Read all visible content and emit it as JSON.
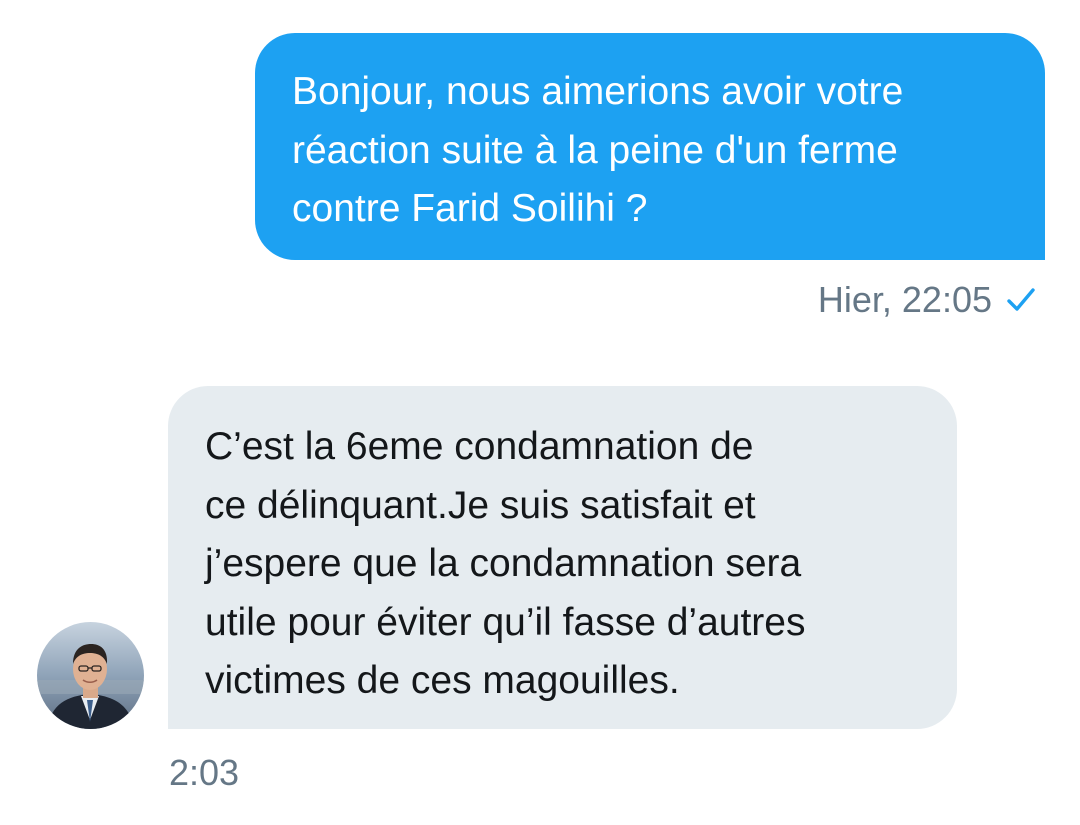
{
  "conversation": {
    "sent_message": {
      "lines": [
        "Bonjour, nous aimerions avoir votre",
        "réaction suite à la peine d'un ferme",
        "contre Farid Soilihi ?"
      ],
      "timestamp": "Hier, 22:05",
      "status_icon": "check-icon",
      "bubble_color": "#1da1f2"
    },
    "received_message": {
      "lines": [
        "C’est la 6eme condamnation de",
        "ce délinquant.Je suis satisfait et",
        "j’espere que la condamnation sera",
        "utile pour éviter qu’il fasse d’autres",
        "victimes de ces magouilles."
      ],
      "timestamp": "2:03",
      "avatar_icon": "avatar",
      "bubble_color": "#e6ecf0"
    },
    "meta_text_color": "#657786"
  }
}
